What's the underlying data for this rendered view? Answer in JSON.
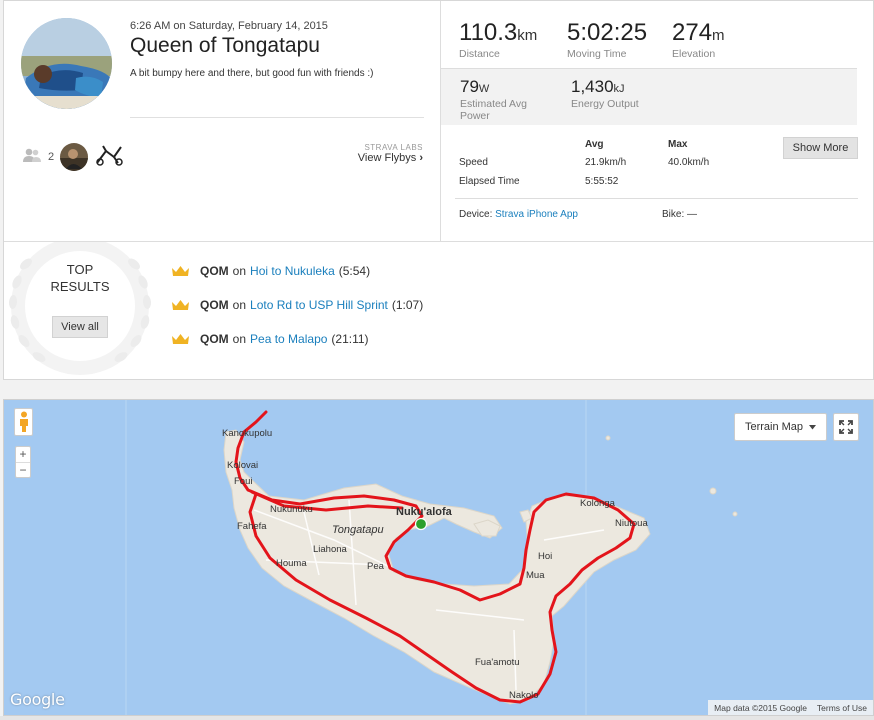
{
  "activity": {
    "datetime": "6:26 AM on Saturday, February 14, 2015",
    "title": "Queen of Tongatapu",
    "description": "A bit bumpy here and there, but good fun with friends :)",
    "athlete_count": "2",
    "labs_tag": "STRAVA LABS",
    "flybys_label": "View Flybys",
    "chevron": "›"
  },
  "stats": {
    "distance": {
      "value": "110.3",
      "unit": "km",
      "label": "Distance"
    },
    "moving_time": {
      "value": "5:02:25",
      "unit": "",
      "label": "Moving Time"
    },
    "elevation": {
      "value": "274",
      "unit": "m",
      "label": "Elevation"
    },
    "power": {
      "value": "79",
      "unit": "W",
      "label_line1": "Estimated Avg",
      "label_line2": "Power"
    },
    "energy": {
      "value": "1,430",
      "unit": "kJ",
      "label": "Energy Output"
    }
  },
  "table": {
    "col_avg": "Avg",
    "col_max": "Max",
    "speed_label": "Speed",
    "speed_avg": "21.9km/h",
    "speed_max": "40.0km/h",
    "elapsed_label": "Elapsed Time",
    "elapsed_avg": "5:55:52",
    "show_more": "Show More"
  },
  "device": {
    "label": "Device:",
    "value": "Strava iPhone App",
    "bike_label": "Bike:",
    "bike_value": "—"
  },
  "top_results": {
    "line1": "TOP",
    "line2": "RESULTS",
    "view_all": "View all",
    "achievements": [
      {
        "badge": "QOM",
        "on": "on",
        "segment": "Hoi to Nukuleka",
        "time": "(5:54)"
      },
      {
        "badge": "QOM",
        "on": "on",
        "segment": "Loto Rd to USP Hill Sprint",
        "time": "(1:07)"
      },
      {
        "badge": "QOM",
        "on": "on",
        "segment": "Pea to Malapo",
        "time": "(21:11)"
      }
    ]
  },
  "map": {
    "map_type": "Terrain Map",
    "zoom_in": "+",
    "zoom_out": "−",
    "google": "Google",
    "attribution": "Map data ©2015 Google",
    "terms": "Terms of Use",
    "places": {
      "kanokupolu": "Kanokupolu",
      "kolovai": "Kolovai",
      "foui": "Foui",
      "nukunuku": "Nukunuku",
      "nukualofa": "Nuku'alofa",
      "tongatapu": "Tongatapu",
      "fahefa": "Fahefa",
      "liahona": "Liahona",
      "houma": "Houma",
      "pea": "Pea",
      "kolonga": "Kolonga",
      "niutoua": "Niutoua",
      "hoi": "Hoi",
      "mua": "Mua",
      "fuaamotu": "Fua'amotu",
      "nakolo": "Nakolo"
    },
    "colors": {
      "sea": "#a3c9f1",
      "land": "#ece8df",
      "route": "#e3141b",
      "start": "#2ca02c"
    }
  }
}
